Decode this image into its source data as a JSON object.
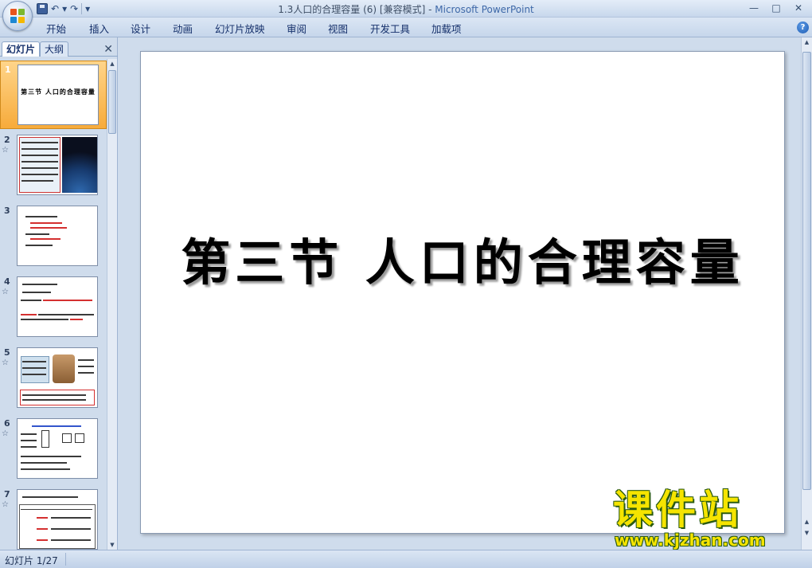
{
  "window": {
    "title": "1.3人口的合理容量 (6) [兼容模式]",
    "app_name": "Microsoft PowerPoint",
    "separator": " - "
  },
  "qat": {
    "undo": "↶",
    "redo": "↷",
    "more": "▾"
  },
  "window_controls": {
    "minimize": "—",
    "maximize": "□",
    "close": "✕"
  },
  "ribbon_tabs": [
    {
      "label": "开始"
    },
    {
      "label": "插入"
    },
    {
      "label": "设计"
    },
    {
      "label": "动画"
    },
    {
      "label": "幻灯片放映"
    },
    {
      "label": "审阅"
    },
    {
      "label": "视图"
    },
    {
      "label": "开发工具"
    },
    {
      "label": "加载项"
    }
  ],
  "help": "?",
  "panel": {
    "tab_slides": "幻灯片",
    "tab_outline": "大纲",
    "close": "✕",
    "anim_marker": "☆",
    "thumbs": [
      {
        "num": "1",
        "title": "第三节 人口的合理容量",
        "selected": true,
        "anim": false
      },
      {
        "num": "2",
        "selected": false,
        "anim": true
      },
      {
        "num": "3",
        "selected": false,
        "anim": false
      },
      {
        "num": "4",
        "selected": false,
        "anim": true
      },
      {
        "num": "5",
        "selected": false,
        "anim": true
      },
      {
        "num": "6",
        "selected": false,
        "anim": true
      },
      {
        "num": "7",
        "selected": false,
        "anim": true
      }
    ]
  },
  "slide": {
    "title": "第三节  人口的合理容量"
  },
  "watermark": {
    "brand": "课件站",
    "url": "www.kjzhan.com"
  },
  "status": {
    "slide_info": "幻灯片 1/27"
  },
  "colors": {
    "selected_thumb": "#f7ab3b",
    "ribbon": "#c6d6eb",
    "watermark": "#f5e400"
  }
}
